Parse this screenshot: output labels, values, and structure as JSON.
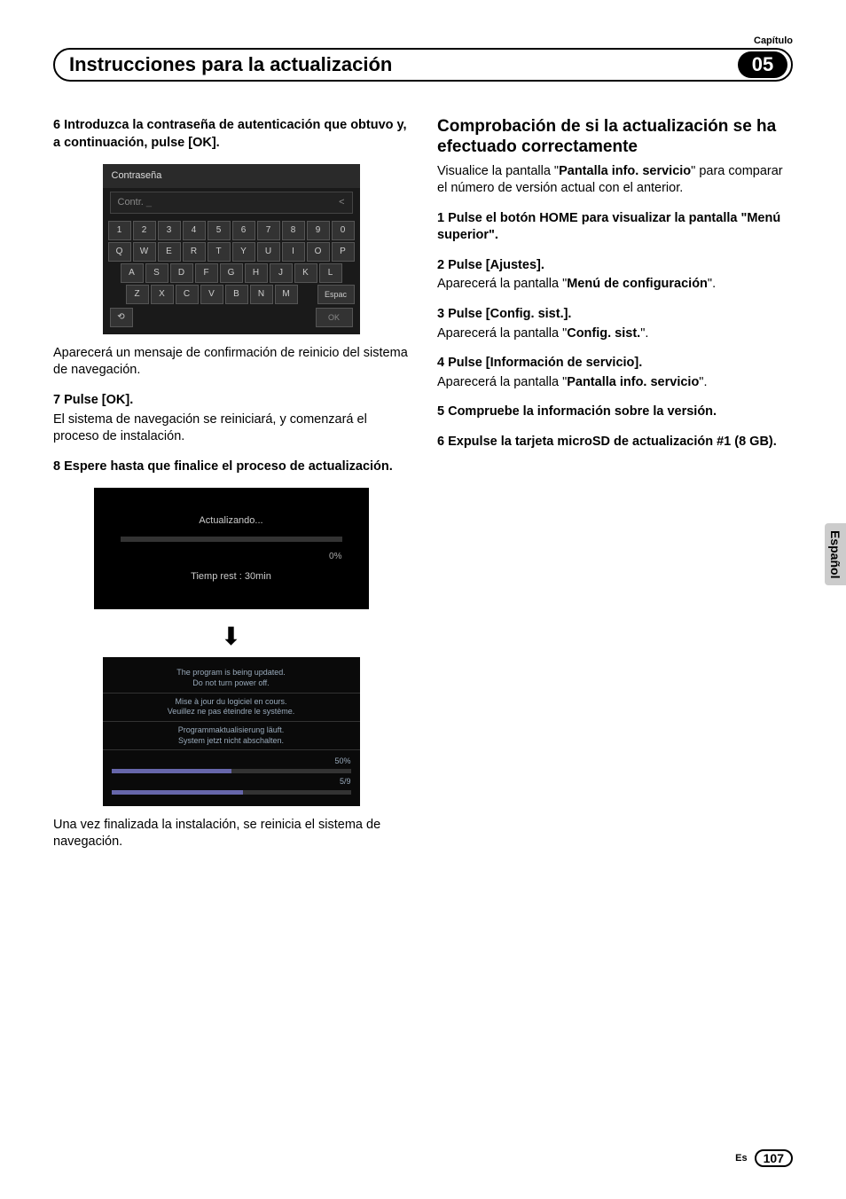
{
  "header": {
    "chapter_label": "Capítulo",
    "title": "Instrucciones para la actualización",
    "chapter_number": "05"
  },
  "left": {
    "step6": "6   Introduzca la contraseña de autenticación que obtuvo y, a continuación, pulse [OK].",
    "keyboard": {
      "title": "Contraseña",
      "input_label": "Contr.",
      "cursor": "_",
      "backspace": "<",
      "rows": [
        [
          "1",
          "2",
          "3",
          "4",
          "5",
          "6",
          "7",
          "8",
          "9",
          "0"
        ],
        [
          "Q",
          "W",
          "E",
          "R",
          "T",
          "Y",
          "U",
          "I",
          "O",
          "P"
        ],
        [
          "A",
          "S",
          "D",
          "F",
          "G",
          "H",
          "J",
          "K",
          "L"
        ],
        [
          "Z",
          "X",
          "C",
          "V",
          "B",
          "N",
          "M"
        ]
      ],
      "space": "Espac",
      "back_icon": "⟲",
      "ok": "OK"
    },
    "after_kb": "Aparecerá un mensaje de confirmación de reinicio del sistema de navegación.",
    "step7": "7   Pulse [OK].",
    "step7_text": "El sistema de navegación se reiniciará, y comenzará el proceso de instalación.",
    "step8": "8   Espere hasta que finalice el proceso de actualización.",
    "updating": {
      "label": "Actualizando...",
      "pct": "0%",
      "time": "Tiemp rest :  30min"
    },
    "multi": {
      "en1": "The program is being updated.",
      "en2": "Do not turn power off.",
      "fr1": "Mise à jour du logiciel en cours.",
      "fr2": "Veuillez ne pas éteindre le système.",
      "de1": "Programmaktualisierung läuft.",
      "de2": "System jetzt nicht abschalten.",
      "pct": "50%",
      "count": "5/9"
    },
    "after_install": "Una vez finalizada la instalación, se reinicia el sistema de navegación."
  },
  "right": {
    "heading": "Comprobación de si la actualización se ha efectuado correctamente",
    "intro_pre": "Visualice la pantalla \"",
    "intro_bold": "Pantalla info. servicio",
    "intro_post": "\" para comparar el número de versión actual con el anterior.",
    "step1": "1   Pulse el botón HOME para visualizar la pantalla \"Menú superior\".",
    "step2": "2   Pulse [Ajustes].",
    "step2_pre": "Aparecerá la pantalla \"",
    "step2_bold": "Menú de configuración",
    "step2_post": "\".",
    "step3": "3   Pulse [Config. sist.].",
    "step3_pre": "Aparecerá la pantalla \"",
    "step3_bold": "Config. sist.",
    "step3_post": "\".",
    "step4": "4   Pulse [Información de servicio].",
    "step4_pre": "Aparecerá la pantalla \"",
    "step4_bold": "Pantalla info. servicio",
    "step4_post": "\".",
    "step5": "5   Compruebe la información sobre la versión.",
    "step6": "6   Expulse la tarjeta microSD de actualización #1 (8 GB)."
  },
  "side_tab": "Español",
  "footer": {
    "lang": "Es",
    "page": "107"
  }
}
